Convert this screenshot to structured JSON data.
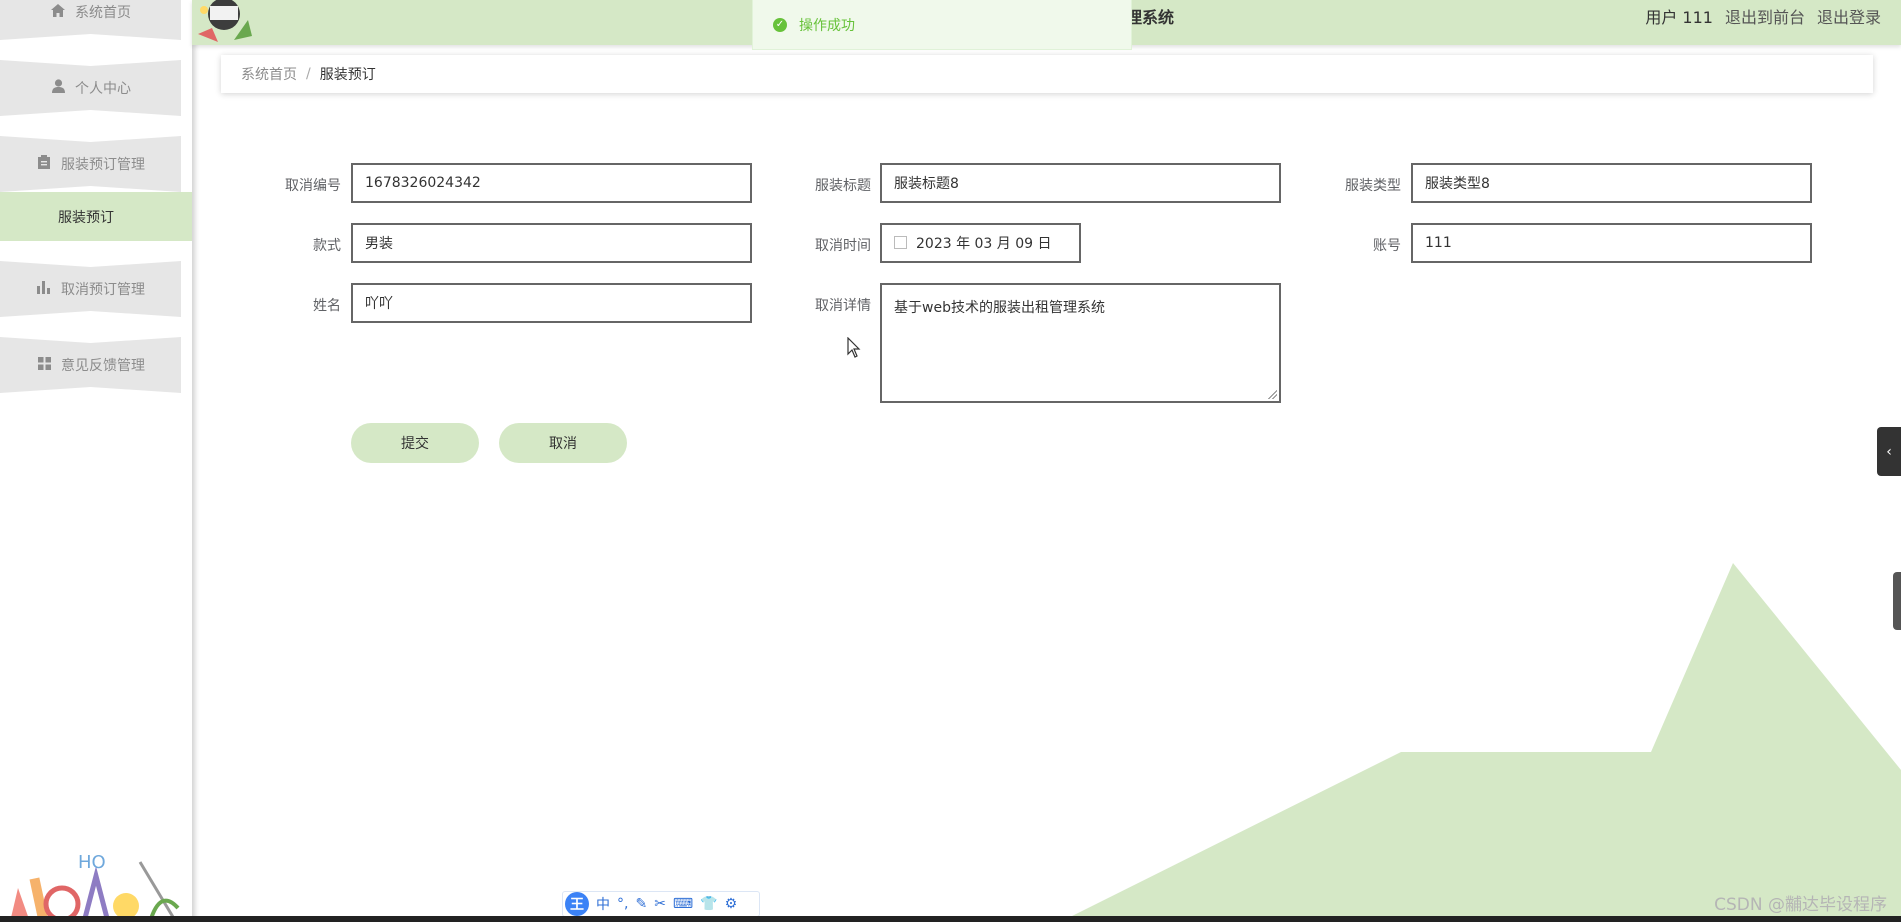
{
  "colors": {
    "accent": "#d5e8c6",
    "toast_bg": "#f0f9eb",
    "toast_text": "#67c23a",
    "ime_blue": "#3b82f6"
  },
  "sidebar": {
    "items": [
      {
        "label": "系统首页",
        "icon": "home-icon"
      },
      {
        "label": "个人中心",
        "icon": "user-icon"
      },
      {
        "label": "服装预订管理",
        "icon": "clipboard-icon"
      },
      {
        "label": "取消预订管理",
        "icon": "bar-chart-icon"
      },
      {
        "label": "意见反馈管理",
        "icon": "grid-icon"
      }
    ],
    "active_sub_item": "服装预订"
  },
  "header": {
    "title": "理系统",
    "user": "用户 111",
    "back_to_front": "退出到前台",
    "logout": "退出登录"
  },
  "toast": {
    "message": "操作成功"
  },
  "breadcrumb": {
    "home": "系统首页",
    "separator": "/",
    "current": "服装预订"
  },
  "form": {
    "cancel_no": {
      "label": "取消编号",
      "value": "1678326024342"
    },
    "clothing_title": {
      "label": "服装标题",
      "value": "服装标题8"
    },
    "clothing_type": {
      "label": "服装类型",
      "value": "服装类型8"
    },
    "style": {
      "label": "款式",
      "value": "男装"
    },
    "cancel_time": {
      "label": "取消时间",
      "value": "2023 年 03 月 09 日"
    },
    "account": {
      "label": "账号",
      "value": "111"
    },
    "name": {
      "label": "姓名",
      "value": "吖吖"
    },
    "cancel_detail": {
      "label": "取消详情",
      "value": "基于web技术的服装出租管理系统"
    }
  },
  "buttons": {
    "submit": "提交",
    "cancel": "取消"
  },
  "ime": {
    "logo": "王",
    "items": [
      "中",
      "°,",
      "✎",
      "✂",
      "⌨",
      "👕",
      "⚙"
    ]
  },
  "watermark": "CSDN @黼达毕设程序"
}
